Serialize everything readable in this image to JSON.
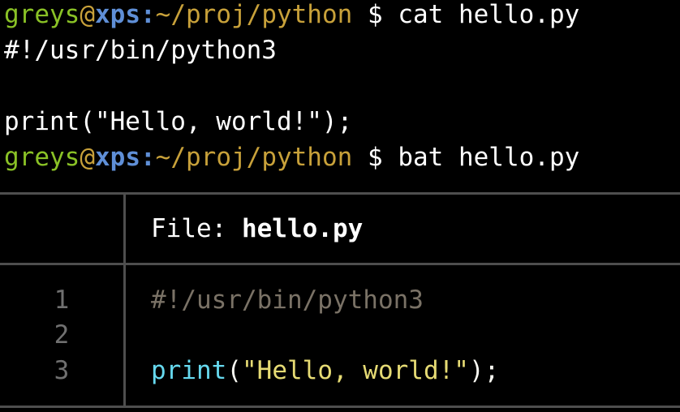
{
  "terminal": {
    "prompt": {
      "user": "greys",
      "at": "@",
      "host": "xps",
      "sep": ":",
      "path": "~/proj/python",
      "symbol": " $ "
    },
    "commands": {
      "cat": "cat hello.py",
      "bat": "bat hello.py"
    },
    "cat_output": {
      "line1": "#!/usr/bin/python3",
      "line3": "print(\"Hello, world!\");"
    },
    "bat_output": {
      "file_label": "File: ",
      "file_name": "hello.py",
      "line_numbers": [
        "1",
        "2",
        "3"
      ],
      "code": {
        "line1": "#!/usr/bin/python3",
        "line3_func": "print",
        "line3_open": "(",
        "line3_string": "\"Hello, world!\"",
        "line3_close": ");"
      }
    }
  },
  "colors": {
    "background": "#000000",
    "user": "#8ac226",
    "host": "#5f8fd7",
    "path": "#c8a13a",
    "comment": "#7a7266",
    "function": "#66d9ef",
    "string": "#e6db74",
    "grid": "#4e4e4e"
  }
}
